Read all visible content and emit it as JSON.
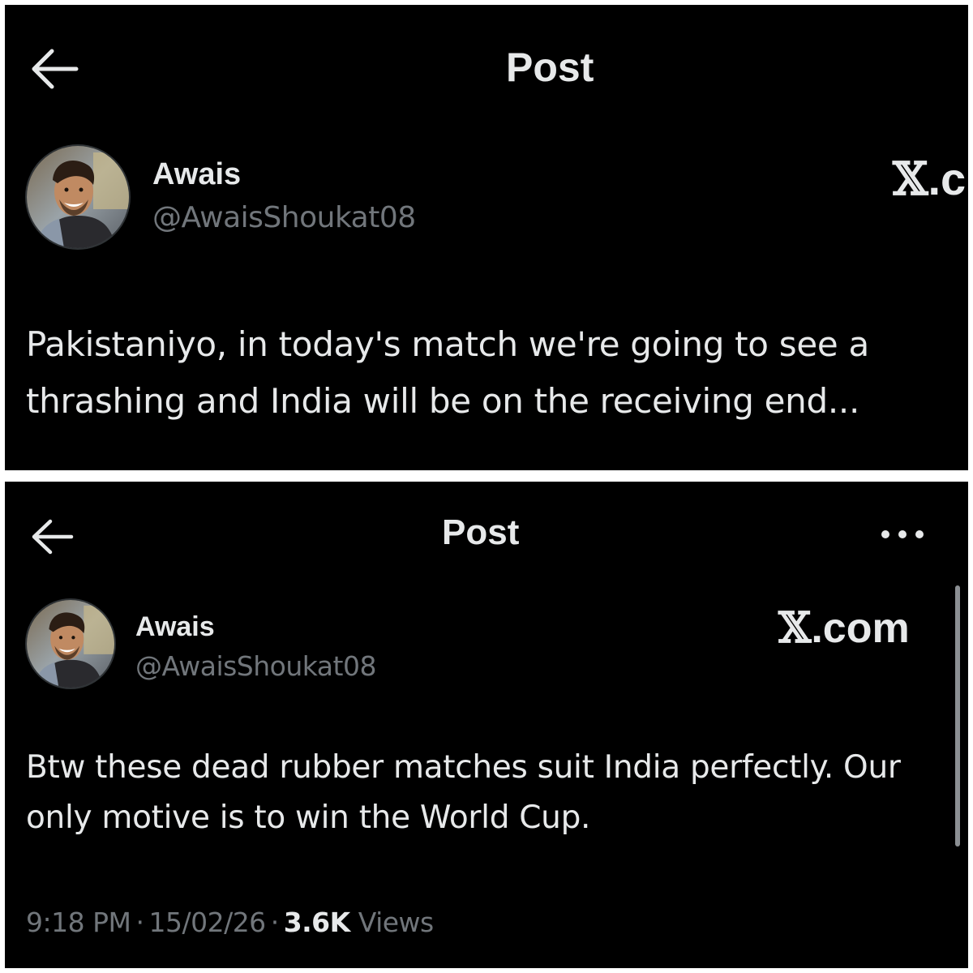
{
  "top_post": {
    "header": {
      "title": "Post",
      "back_icon": "arrow-left-icon"
    },
    "author": {
      "display_name": "Awais",
      "handle": "@AwaisShoukat08"
    },
    "watermark": {
      "x_mark": "𝕏",
      "rest": ".c"
    },
    "text_lines": [
      "Pakistaniyo, in today's match we're going to see a",
      "thrashing and India will be on the receiving end..."
    ]
  },
  "bottom_post": {
    "header": {
      "title": "Post",
      "back_icon": "arrow-left-icon",
      "more_icon": "more-horizontal-icon"
    },
    "author": {
      "display_name": "Awais",
      "handle": "@AwaisShoukat08"
    },
    "watermark": {
      "x_mark": "𝕏",
      "rest": ".com"
    },
    "text_lines": [
      "Btw these dead rubber matches suit India perfectly. Our",
      "only motive is to win the World Cup."
    ],
    "meta": {
      "time": "9:18 PM",
      "date": "15/02/26",
      "views_count": "3.6K",
      "views_label": "Views",
      "separator": "·"
    }
  },
  "colors": {
    "background": "#000000",
    "text_primary": "#e7e9ea",
    "text_secondary": "#71767b",
    "frame": "#ffffff"
  }
}
